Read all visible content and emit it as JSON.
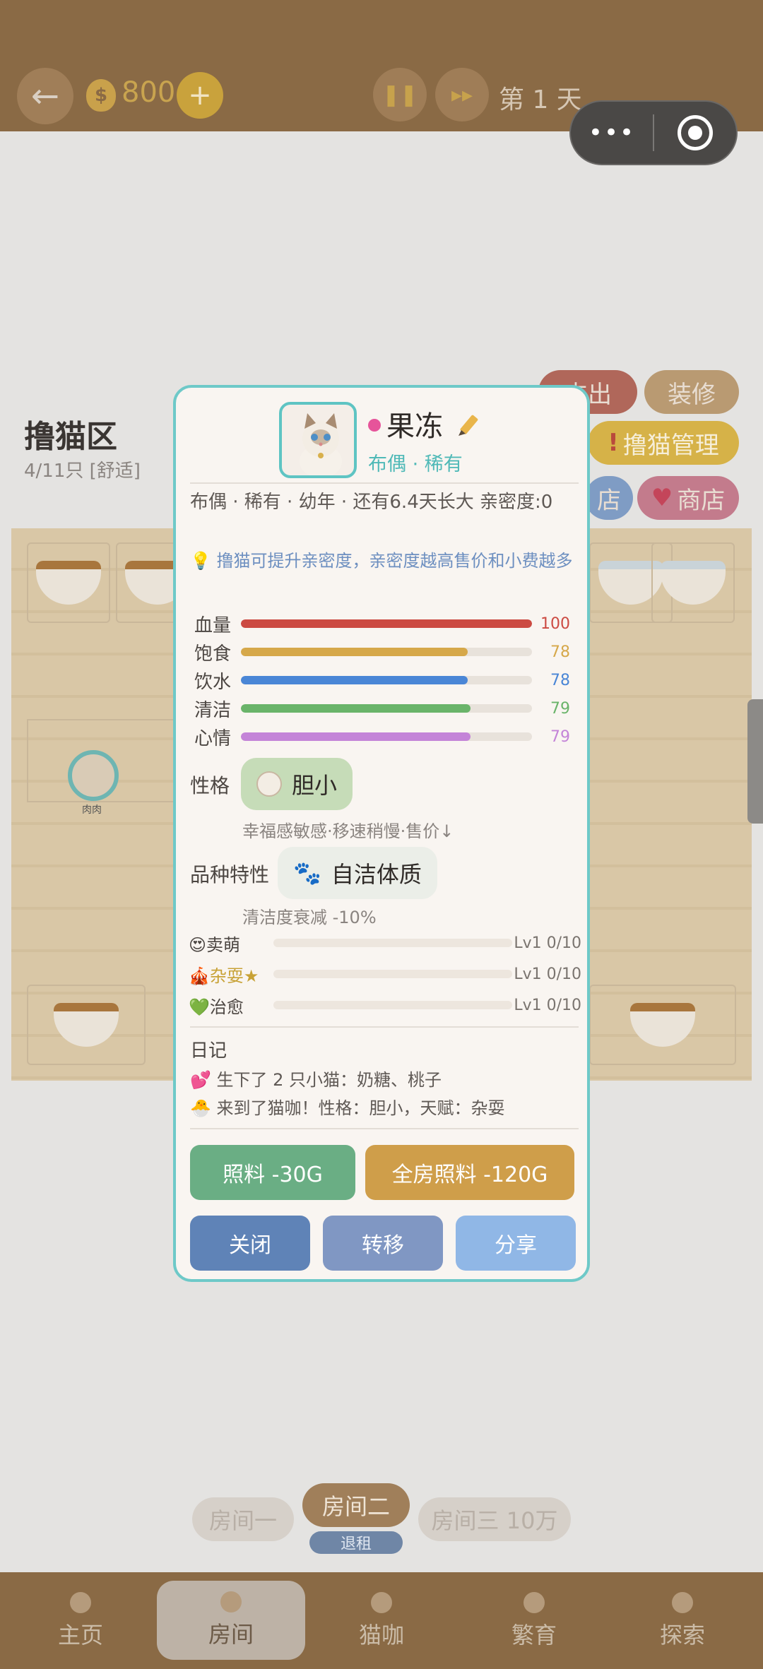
{
  "topbar": {
    "back_icon": "←",
    "coin_icon": "money-bag-icon",
    "coins": "800",
    "add_icon": "+",
    "pause_icon": "❚❚",
    "fast_forward_icon": "▸▸",
    "day": "第 1 天",
    "capsule_more": "•••"
  },
  "area": {
    "title": "撸猫区",
    "subtitle": "4/11只 [舒适]",
    "cat_tag": "肉肉",
    "side_buttons": {
      "expense": "支出",
      "decorate": "装修",
      "manage": "撸猫管理",
      "shop_partial": "店",
      "shop": "商店"
    }
  },
  "modal": {
    "name": "果冻",
    "tags": "布偶 · 稀有",
    "description": "布偶 · 稀有 · 幼年 · 还有6.4天长大  亲密度:0",
    "tip_icon": "💡",
    "tip": "撸猫可提升亲密度，亲密度越高售价和小费越多",
    "stats": [
      {
        "label": "血量",
        "value": "100",
        "percent": 100,
        "color": "#cc4a42"
      },
      {
        "label": "饱食",
        "value": "78",
        "percent": 78,
        "color": "#d6a84a"
      },
      {
        "label": "饮水",
        "value": "78",
        "percent": 78,
        "color": "#4a86d6"
      },
      {
        "label": "清洁",
        "value": "79",
        "percent": 79,
        "color": "#6ab46a"
      },
      {
        "label": "心情",
        "value": "79",
        "percent": 79,
        "color": "#c484d8"
      }
    ],
    "personality": {
      "label": "性格",
      "value": "胆小",
      "effect": "幸福感敏感·移速稍慢·售价↓"
    },
    "breed_trait": {
      "label": "品种特性",
      "icon": "🐾",
      "value": "自洁体质",
      "effect": "清洁度衰减 -10%"
    },
    "skills": [
      {
        "icon": "😍",
        "name": "卖萌",
        "level": "Lv1 0/10",
        "color": "#4c4642"
      },
      {
        "icon": "🎪",
        "name": "杂耍",
        "star": "★",
        "level": "Lv1 0/10",
        "color": "#c8a236"
      },
      {
        "icon": "💚",
        "name": "治愈",
        "level": "Lv1 0/10",
        "color": "#4c4642"
      }
    ],
    "diary": {
      "title": "日记",
      "entries": [
        {
          "icon": "💕",
          "text": "生下了 2 只小猫：奶糖、桃子"
        },
        {
          "icon": "🐣",
          "text": "来到了猫咖！性格：胆小，天赋：杂耍"
        }
      ]
    },
    "buttons": {
      "feed": "照料 -30G",
      "feed_all": "全房照料 -120G",
      "close": "关闭",
      "transfer": "转移",
      "share": "分享"
    }
  },
  "rooms": {
    "room1": "房间一",
    "room2": "房间二",
    "room2_sub": "退租",
    "room3": "房间三 10万"
  },
  "nav": {
    "home": "主页",
    "room": "房间",
    "cafe": "猫咖",
    "breed": "繁育",
    "explore": "探索"
  }
}
